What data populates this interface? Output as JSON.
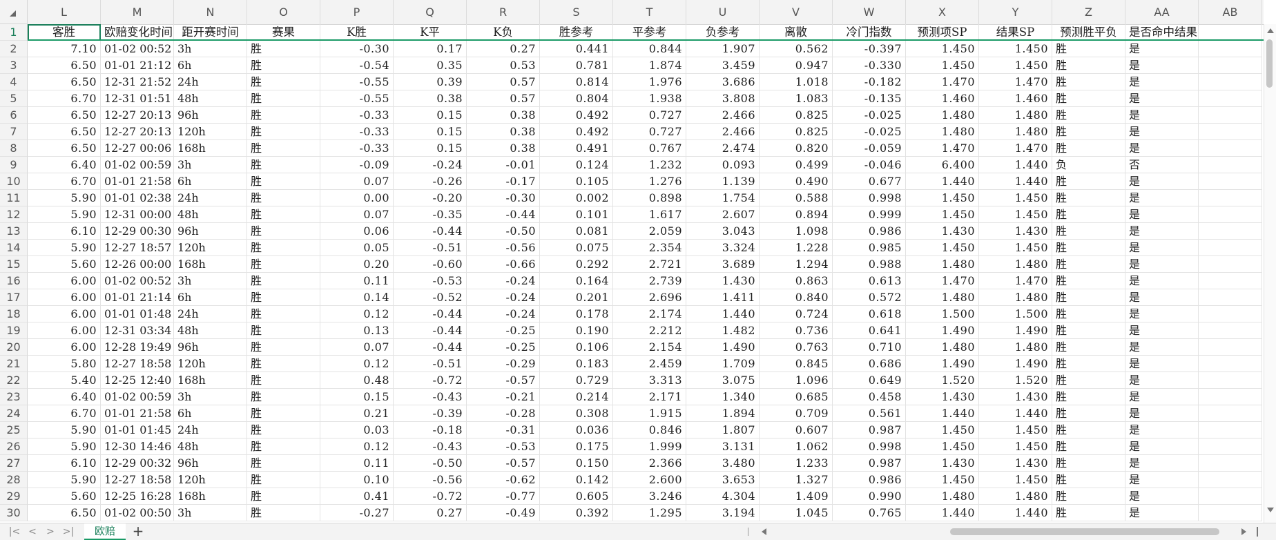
{
  "sheet": {
    "columns": [
      "L",
      "M",
      "N",
      "O",
      "P",
      "Q",
      "R",
      "S",
      "T",
      "U",
      "V",
      "W",
      "X",
      "Y",
      "Z",
      "AA",
      "AB"
    ],
    "headers": [
      "客胜",
      "欧赔变化时间",
      "距开赛时间",
      "赛果",
      "K胜",
      "K平",
      "K负",
      "胜参考",
      "平参考",
      "负参考",
      "离散",
      "冷门指数",
      "预测项SP",
      "结果SP",
      "预测胜平负",
      "是否命中结果",
      ""
    ],
    "rows": [
      [
        "7.10",
        "01-02 00:52",
        "3h",
        "胜",
        "-0.30",
        "0.17",
        "0.27",
        "0.441",
        "0.844",
        "1.907",
        "0.562",
        "-0.397",
        "1.450",
        "1.450",
        "胜",
        "是"
      ],
      [
        "6.50",
        "01-01 21:12",
        "6h",
        "胜",
        "-0.54",
        "0.35",
        "0.53",
        "0.781",
        "1.874",
        "3.459",
        "0.947",
        "-0.330",
        "1.450",
        "1.450",
        "胜",
        "是"
      ],
      [
        "6.50",
        "12-31 21:52",
        "24h",
        "胜",
        "-0.55",
        "0.39",
        "0.57",
        "0.814",
        "1.976",
        "3.686",
        "1.018",
        "-0.182",
        "1.470",
        "1.470",
        "胜",
        "是"
      ],
      [
        "6.70",
        "12-31 01:51",
        "48h",
        "胜",
        "-0.55",
        "0.38",
        "0.57",
        "0.804",
        "1.938",
        "3.808",
        "1.083",
        "-0.135",
        "1.460",
        "1.460",
        "胜",
        "是"
      ],
      [
        "6.50",
        "12-27 20:13",
        "96h",
        "胜",
        "-0.33",
        "0.15",
        "0.38",
        "0.492",
        "0.727",
        "2.466",
        "0.825",
        "-0.025",
        "1.480",
        "1.480",
        "胜",
        "是"
      ],
      [
        "6.50",
        "12-27 20:13",
        "120h",
        "胜",
        "-0.33",
        "0.15",
        "0.38",
        "0.492",
        "0.727",
        "2.466",
        "0.825",
        "-0.025",
        "1.480",
        "1.480",
        "胜",
        "是"
      ],
      [
        "6.50",
        "12-27 00:06",
        "168h",
        "胜",
        "-0.33",
        "0.15",
        "0.38",
        "0.491",
        "0.767",
        "2.474",
        "0.820",
        "-0.059",
        "1.470",
        "1.470",
        "胜",
        "是"
      ],
      [
        "6.40",
        "01-02 00:59",
        "3h",
        "胜",
        "-0.09",
        "-0.24",
        "-0.01",
        "0.124",
        "1.232",
        "0.093",
        "0.499",
        "-0.046",
        "6.400",
        "1.440",
        "负",
        "否"
      ],
      [
        "6.70",
        "01-01 21:58",
        "6h",
        "胜",
        "0.07",
        "-0.26",
        "-0.17",
        "0.105",
        "1.276",
        "1.139",
        "0.490",
        "0.677",
        "1.440",
        "1.440",
        "胜",
        "是"
      ],
      [
        "5.90",
        "01-01 02:38",
        "24h",
        "胜",
        "0.00",
        "-0.20",
        "-0.30",
        "0.002",
        "0.898",
        "1.754",
        "0.588",
        "0.998",
        "1.450",
        "1.450",
        "胜",
        "是"
      ],
      [
        "5.90",
        "12-31 00:00",
        "48h",
        "胜",
        "0.07",
        "-0.35",
        "-0.44",
        "0.101",
        "1.617",
        "2.607",
        "0.894",
        "0.999",
        "1.450",
        "1.450",
        "胜",
        "是"
      ],
      [
        "6.10",
        "12-29 00:30",
        "96h",
        "胜",
        "0.06",
        "-0.44",
        "-0.50",
        "0.081",
        "2.059",
        "3.043",
        "1.098",
        "0.986",
        "1.430",
        "1.430",
        "胜",
        "是"
      ],
      [
        "5.90",
        "12-27 18:57",
        "120h",
        "胜",
        "0.05",
        "-0.51",
        "-0.56",
        "0.075",
        "2.354",
        "3.324",
        "1.228",
        "0.985",
        "1.450",
        "1.450",
        "胜",
        "是"
      ],
      [
        "5.60",
        "12-26 00:00",
        "168h",
        "胜",
        "0.20",
        "-0.60",
        "-0.66",
        "0.292",
        "2.721",
        "3.689",
        "1.294",
        "0.988",
        "1.480",
        "1.480",
        "胜",
        "是"
      ],
      [
        "6.00",
        "01-02 00:52",
        "3h",
        "胜",
        "0.11",
        "-0.53",
        "-0.24",
        "0.164",
        "2.739",
        "1.430",
        "0.863",
        "0.613",
        "1.470",
        "1.470",
        "胜",
        "是"
      ],
      [
        "6.00",
        "01-01 21:14",
        "6h",
        "胜",
        "0.14",
        "-0.52",
        "-0.24",
        "0.201",
        "2.696",
        "1.411",
        "0.840",
        "0.572",
        "1.480",
        "1.480",
        "胜",
        "是"
      ],
      [
        "6.00",
        "01-01 01:48",
        "24h",
        "胜",
        "0.12",
        "-0.44",
        "-0.24",
        "0.178",
        "2.174",
        "1.440",
        "0.724",
        "0.618",
        "1.500",
        "1.500",
        "胜",
        "是"
      ],
      [
        "6.00",
        "12-31 03:34",
        "48h",
        "胜",
        "0.13",
        "-0.44",
        "-0.25",
        "0.190",
        "2.212",
        "1.482",
        "0.736",
        "0.641",
        "1.490",
        "1.490",
        "胜",
        "是"
      ],
      [
        "6.00",
        "12-28 19:49",
        "96h",
        "胜",
        "0.07",
        "-0.44",
        "-0.25",
        "0.106",
        "2.154",
        "1.490",
        "0.763",
        "0.710",
        "1.480",
        "1.480",
        "胜",
        "是"
      ],
      [
        "5.80",
        "12-27 18:58",
        "120h",
        "胜",
        "0.12",
        "-0.51",
        "-0.29",
        "0.183",
        "2.459",
        "1.709",
        "0.845",
        "0.686",
        "1.490",
        "1.490",
        "胜",
        "是"
      ],
      [
        "5.40",
        "12-25 12:40",
        "168h",
        "胜",
        "0.48",
        "-0.72",
        "-0.57",
        "0.729",
        "3.313",
        "3.075",
        "1.096",
        "0.649",
        "1.520",
        "1.520",
        "胜",
        "是"
      ],
      [
        "6.40",
        "01-02 00:59",
        "3h",
        "胜",
        "0.15",
        "-0.43",
        "-0.21",
        "0.214",
        "2.171",
        "1.340",
        "0.685",
        "0.458",
        "1.430",
        "1.430",
        "胜",
        "是"
      ],
      [
        "6.70",
        "01-01 21:58",
        "6h",
        "胜",
        "0.21",
        "-0.39",
        "-0.28",
        "0.308",
        "1.915",
        "1.894",
        "0.709",
        "0.561",
        "1.440",
        "1.440",
        "胜",
        "是"
      ],
      [
        "5.90",
        "01-01 01:45",
        "24h",
        "胜",
        "0.03",
        "-0.18",
        "-0.31",
        "0.036",
        "0.846",
        "1.807",
        "0.607",
        "0.987",
        "1.450",
        "1.450",
        "胜",
        "是"
      ],
      [
        "5.90",
        "12-30 14:46",
        "48h",
        "胜",
        "0.12",
        "-0.43",
        "-0.53",
        "0.175",
        "1.999",
        "3.131",
        "1.062",
        "0.998",
        "1.450",
        "1.450",
        "胜",
        "是"
      ],
      [
        "6.10",
        "12-29 00:32",
        "96h",
        "胜",
        "0.11",
        "-0.50",
        "-0.57",
        "0.150",
        "2.366",
        "3.480",
        "1.233",
        "0.987",
        "1.430",
        "1.430",
        "胜",
        "是"
      ],
      [
        "5.90",
        "12-27 18:58",
        "120h",
        "胜",
        "0.10",
        "-0.56",
        "-0.62",
        "0.142",
        "2.600",
        "3.653",
        "1.327",
        "0.986",
        "1.450",
        "1.450",
        "胜",
        "是"
      ],
      [
        "5.60",
        "12-25 16:28",
        "168h",
        "胜",
        "0.41",
        "-0.72",
        "-0.77",
        "0.605",
        "3.246",
        "4.304",
        "1.409",
        "0.990",
        "1.480",
        "1.480",
        "胜",
        "是"
      ],
      [
        "6.50",
        "01-02 00:50",
        "3h",
        "胜",
        "-0.27",
        "0.27",
        "-0.49",
        "0.392",
        "1.295",
        "3.194",
        "1.045",
        "0.765",
        "1.440",
        "1.440",
        "胜",
        "是"
      ]
    ]
  },
  "tabbar": {
    "nav": [
      "|<",
      "<",
      ">",
      ">|"
    ],
    "sheet_tab_label": "欧赔",
    "add_label": "+"
  },
  "colors": {
    "accent": "#1a9a66",
    "header_bg": "#f3f3f3",
    "grid": "#e3e3e3"
  }
}
